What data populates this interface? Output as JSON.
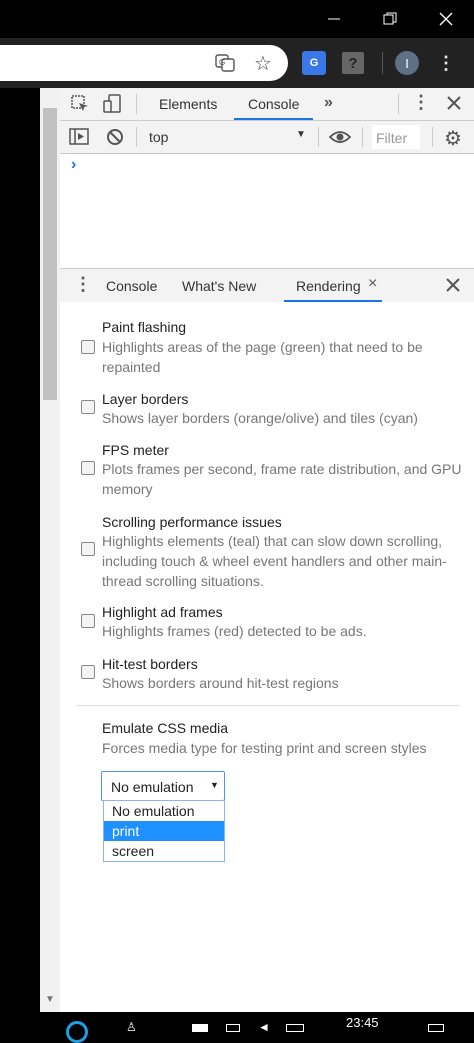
{
  "window": {
    "minimize_icon": "minimize-icon",
    "restore_icon": "restore-icon",
    "close_icon": "close-icon"
  },
  "browser": {
    "profile_initial": "I"
  },
  "devtools": {
    "tabs": [
      "Elements",
      "Console"
    ],
    "active_tab": "Console",
    "context": "top",
    "filter_placeholder": "Filter",
    "prompt": "›",
    "drawer": {
      "tabs": [
        "Console",
        "What's New",
        "Rendering"
      ],
      "active_tab": "Rendering",
      "tab_close": "×"
    },
    "rendering": {
      "options": [
        {
          "title": "Paint flashing",
          "desc": "Highlights areas of the page (green) that need to be repainted"
        },
        {
          "title": "Layer borders",
          "desc": "Shows layer borders (orange/olive) and tiles (cyan)"
        },
        {
          "title": "FPS meter",
          "desc": "Plots frames per second, frame rate distribution, and GPU memory"
        },
        {
          "title": "Scrolling performance issues",
          "desc": "Highlights elements (teal) that can slow down scrolling, including touch & wheel event handlers and other main-thread scrolling situations."
        },
        {
          "title": "Highlight ad frames",
          "desc": "Highlights frames (red) detected to be ads."
        },
        {
          "title": "Hit-test borders",
          "desc": "Shows borders around hit-test regions"
        }
      ],
      "emulate": {
        "title": "Emulate CSS media",
        "desc": "Forces media type for testing print and screen styles",
        "selected": "No emulation",
        "options": [
          "No emulation",
          "print",
          "screen"
        ],
        "highlighted": "print"
      }
    }
  },
  "taskbar": {
    "time": "23:45"
  },
  "colors": {
    "accent": "#1a73e8",
    "highlight": "#1e90ff"
  }
}
